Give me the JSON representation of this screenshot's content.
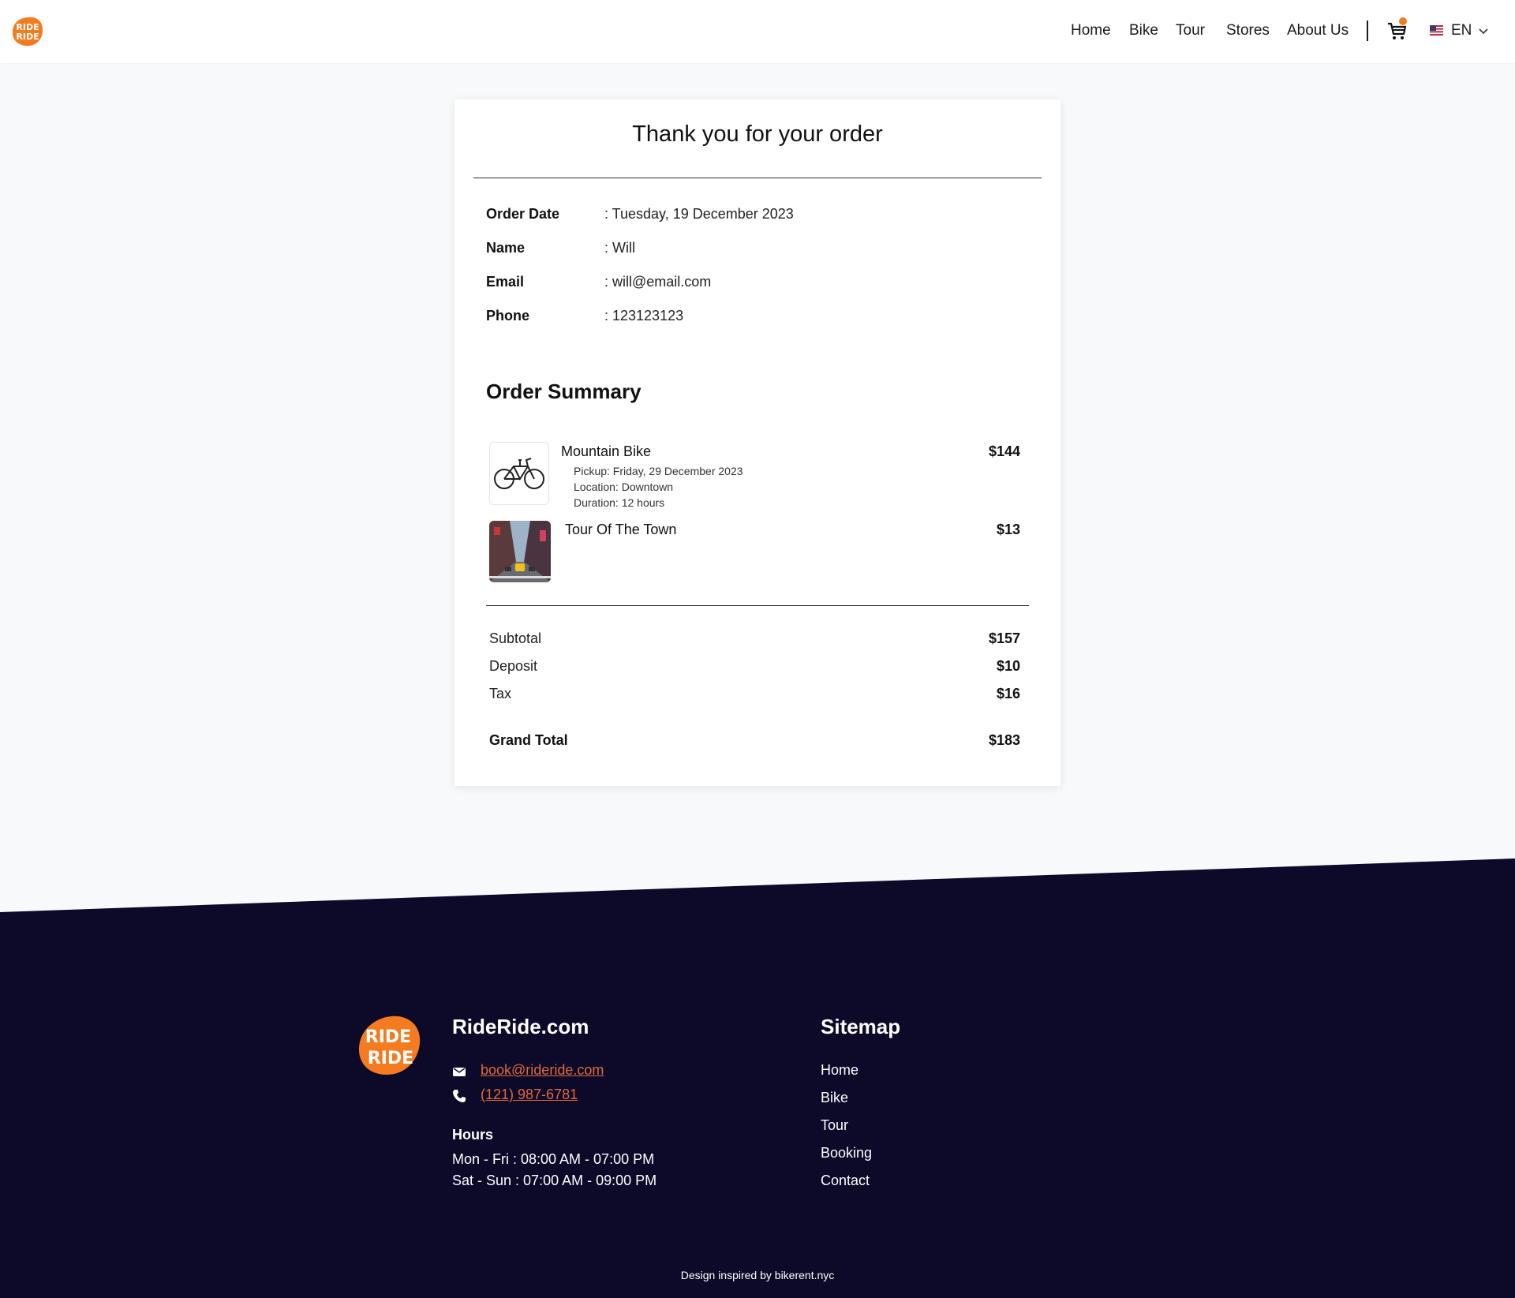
{
  "colors": {
    "brand_orange": "#f47b20",
    "footer_navy": "#0c0929",
    "footer_link": "#e2683a"
  },
  "header": {
    "logo_text": "RIDE RIDE",
    "nav": [
      "Home",
      "Bike",
      "Tour",
      "Stores",
      "About Us"
    ],
    "cart_icon": "cart-icon",
    "flag_icon": "us-flag-icon",
    "language": "EN",
    "chevron_icon": "chevron-down-icon"
  },
  "order": {
    "title": "Thank you for your order",
    "info": [
      {
        "label": "Order Date",
        "value": ": Tuesday, 19 December 2023"
      },
      {
        "label": "Name",
        "value": ": Will"
      },
      {
        "label": "Email",
        "value": ": will@email.com"
      },
      {
        "label": "Phone",
        "value": ": 123123123"
      }
    ],
    "summary_title": "Order Summary",
    "items": [
      {
        "name": "Mountain Bike",
        "price": "$144",
        "details": [
          "Pickup: Friday, 29 December 2023",
          "Location: Downtown",
          "Duration: 12 hours"
        ],
        "thumb_icon": "bicycle-icon"
      },
      {
        "name": "Tour Of The Town",
        "price": "$13",
        "details": [],
        "thumb_icon": "city-street-image"
      }
    ],
    "totals": [
      {
        "label": "Subtotal",
        "value": "$157"
      },
      {
        "label": "Deposit",
        "value": "$10"
      },
      {
        "label": "Tax",
        "value": "$16"
      }
    ],
    "grand_total": {
      "label": "Grand Total",
      "value": "$183"
    }
  },
  "footer": {
    "logo_text": "RIDE RIDE",
    "brand": "RideRide.com",
    "email": "book@rideride.com",
    "phone": "(121) 987-6781",
    "email_icon": "mail-icon",
    "phone_icon": "phone-icon",
    "hours_title": "Hours",
    "hours": [
      "Mon - Fri : 08:00 AM - 07:00 PM",
      "Sat - Sun : 07:00 AM - 09:00 PM"
    ],
    "sitemap_title": "Sitemap",
    "sitemap": [
      "Home",
      "Bike",
      "Tour",
      "Booking",
      "Contact"
    ],
    "credit": "Design inspired by bikerent.nyc"
  }
}
